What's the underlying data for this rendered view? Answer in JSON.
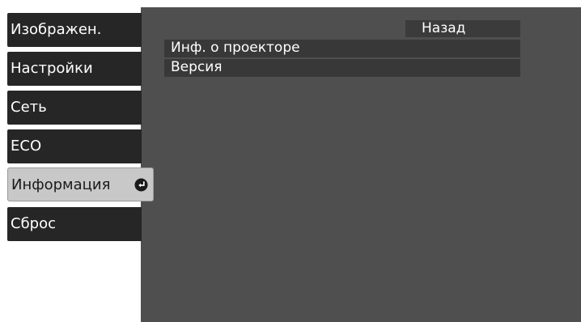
{
  "sidebar": {
    "items": [
      {
        "label": "Изображен."
      },
      {
        "label": "Настройки"
      },
      {
        "label": "Сеть"
      },
      {
        "label": "ECO"
      },
      {
        "label": "Информация",
        "active": true,
        "icon": "enter-icon"
      },
      {
        "label": "Сброс"
      }
    ]
  },
  "main": {
    "back_label": "Назад",
    "rows": [
      {
        "label": "Инф. о проекторе"
      },
      {
        "label": "Версия"
      }
    ]
  },
  "colors": {
    "panel_bg": "#4f4f4f",
    "tab_bg": "#262626",
    "tab_active_bg": "#c8c8c8",
    "row_bg": "#383838",
    "text": "#ffffff"
  }
}
